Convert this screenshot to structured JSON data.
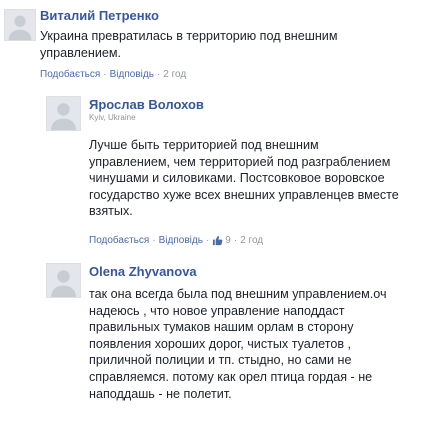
{
  "comments": [
    {
      "author": "Виталий Петренко",
      "text": "Украина превратилась в территорию под внешним\nуправлением.",
      "reply_label": "Подобається",
      "answer_label": "Відповідь",
      "time": "2 год"
    },
    {
      "author": "Ярослав Волохов",
      "location": "Kyiv, Ukraine",
      "text": "Лучше быть территорией под внешним\nуправлением, чем территорией под разграблением\nчинушами и силовиками. Постсовковое воровское\nгосударство хуже всех внешних управленцев вместе\nвзятых.",
      "reply_label": "Подобається",
      "answer_label": "Відповідь",
      "likes": "9",
      "time": "2 год"
    },
    {
      "author": "Olena Zhyvanova",
      "text": "так она всегда была под внешним управлением.оч\nнадеюсь , что новое управление наподдаст\nправильных тумаков нашим орлам в сторону\nпоявления хороших дорог, чистых туалетов ,\nприличной полиции и тп. стыдно, но сами не\nсправляемся. потому как орел птица гордая - не\nнаподдашь - не полетит."
    }
  ],
  "colors": {
    "author": "#365899",
    "link": "#4b6aa8",
    "meta": "#90949c",
    "text": "#1d2129",
    "like_icon": "#4b6aa8"
  },
  "icons": [
    "avatar-placeholder-icon",
    "thumbs-up-icon"
  ]
}
